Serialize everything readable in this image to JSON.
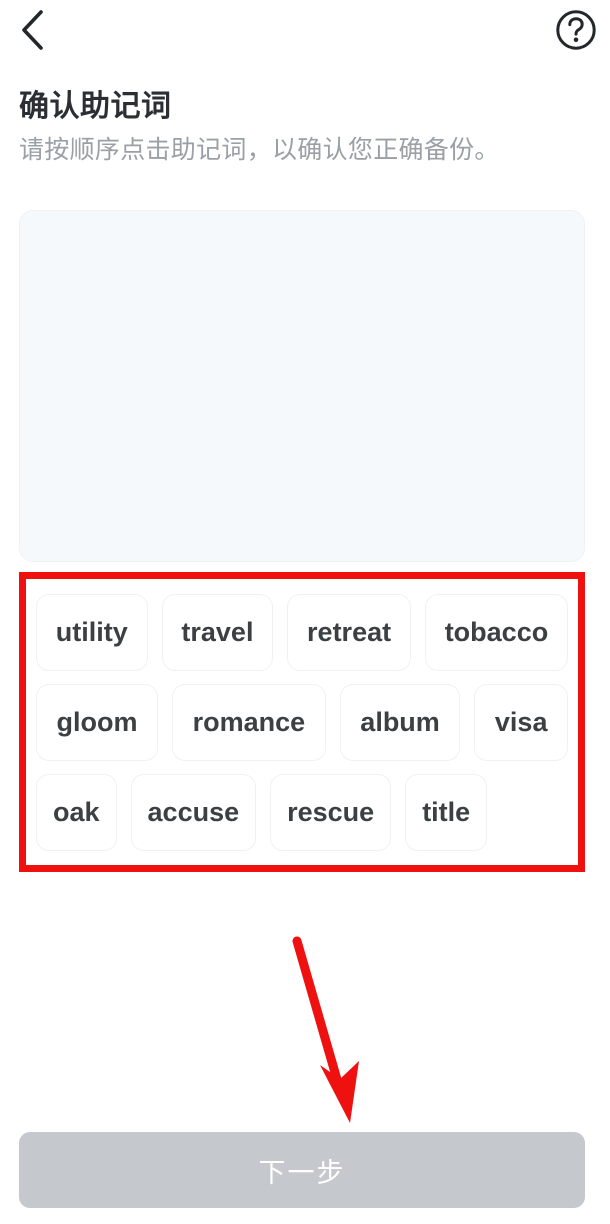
{
  "navbar": {
    "back_icon": "chevron-left-icon",
    "help_icon": "help-circle-icon"
  },
  "header": {
    "title": "确认助记词",
    "subtitle": "请按顺序点击助记词，以确认您正确备份。"
  },
  "answer_panel": {
    "selected_words": [],
    "placeholder": ""
  },
  "word_pool": {
    "rows": [
      [
        "utility",
        "travel",
        "retreat",
        "tobacco"
      ],
      [
        "gloom",
        "romance",
        "album",
        "visa"
      ],
      [
        "oak",
        "accuse",
        "rescue",
        "title"
      ]
    ],
    "words": [
      "utility",
      "travel",
      "retreat",
      "tobacco",
      "gloom",
      "romance",
      "album",
      "visa",
      "oak",
      "accuse",
      "rescue",
      "title"
    ]
  },
  "footer": {
    "next_label": "下一步",
    "next_enabled": false
  },
  "annotations": {
    "highlight_color": "#ef1010",
    "arrow_color": "#ef1010",
    "arrow_name": "red-arrow-to-next-button"
  },
  "colors": {
    "page_background": "#ffffff",
    "panel_background": "#f6f9fc",
    "chip_background": "#ffffff",
    "chip_border": "#f0f1f3",
    "title_text": "#2b2f33",
    "subtitle_text": "#9aa0a6",
    "chip_text": "#3c4043",
    "button_disabled": "#c5c9ce",
    "button_text": "#ffffff"
  }
}
